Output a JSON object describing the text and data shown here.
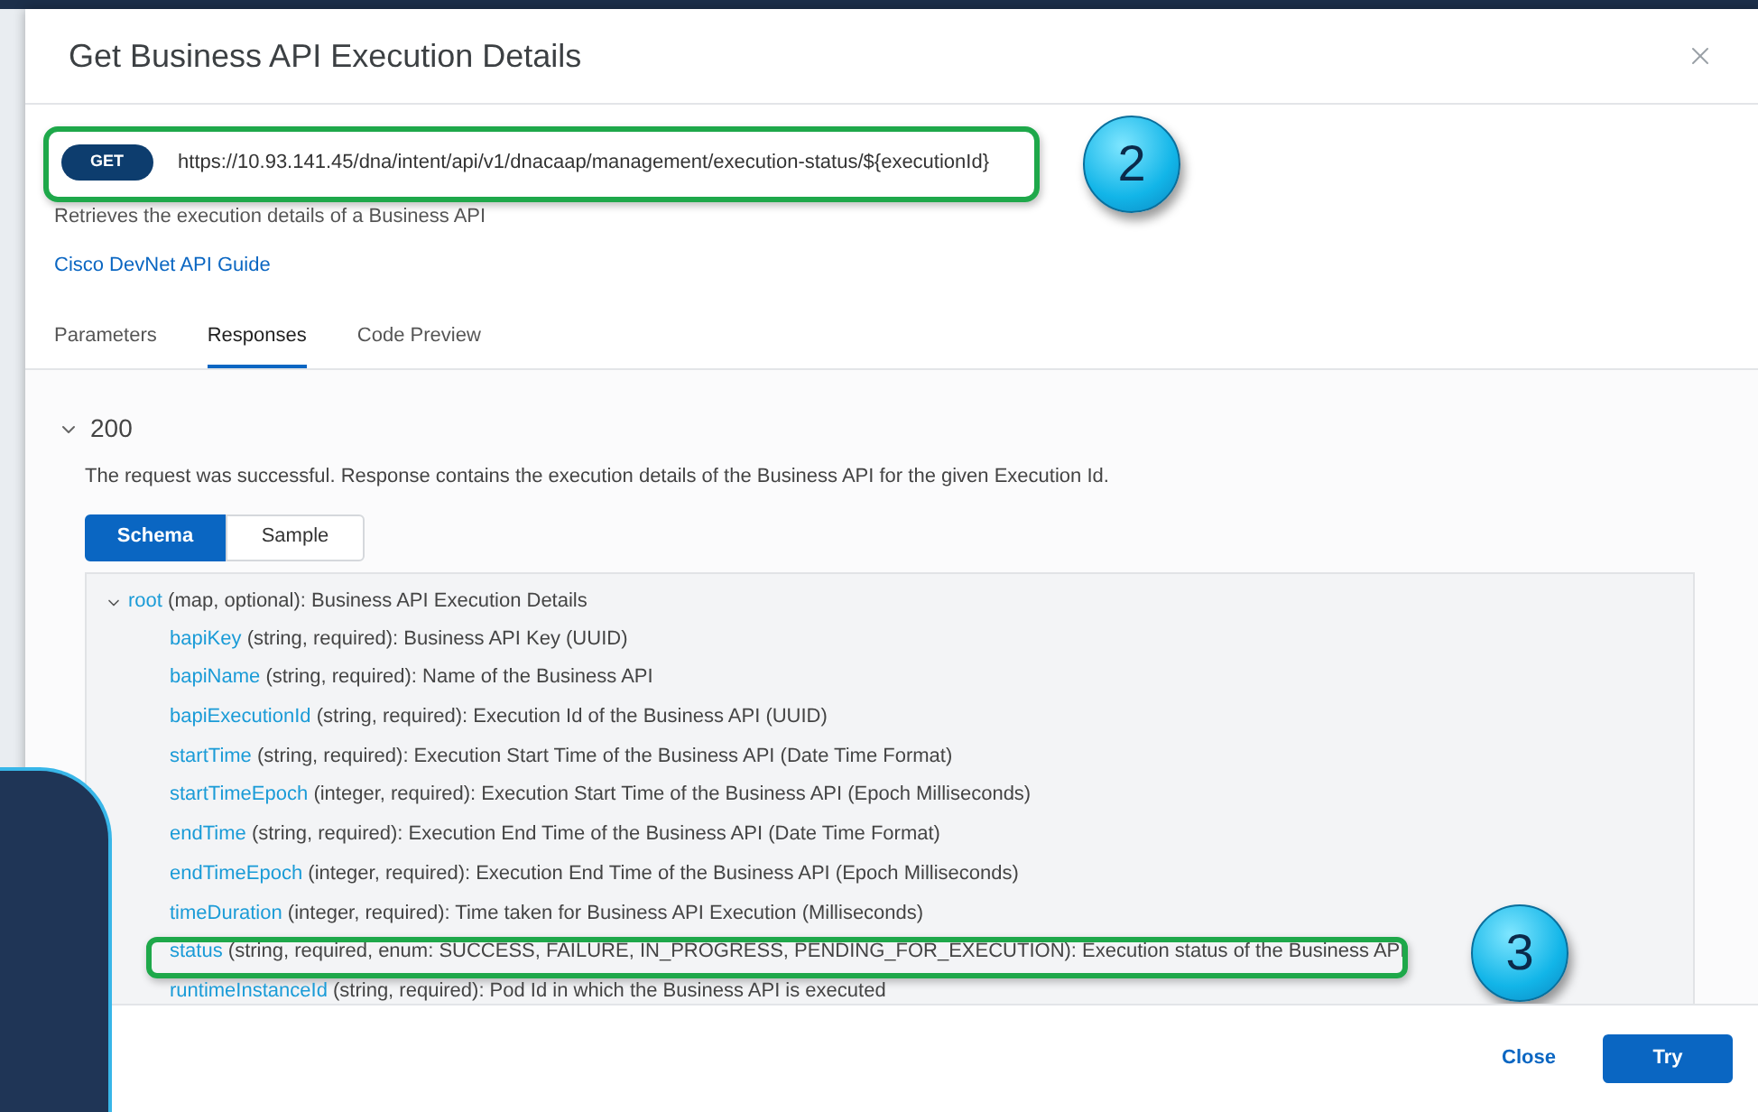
{
  "dialog": {
    "title": "Get Business API Execution Details"
  },
  "endpoint": {
    "method": "GET",
    "url": "https://10.93.141.45/dna/intent/api/v1/dnacaap/management/execution-status/${executionId}",
    "highlighted": true,
    "callout": "2"
  },
  "description": "Retrieves the execution details of a Business API",
  "guide_link": "Cisco DevNet API Guide",
  "tabs": [
    {
      "label": "Parameters",
      "selected": false
    },
    {
      "label": "Responses",
      "selected": true
    },
    {
      "label": "Code Preview",
      "selected": false
    }
  ],
  "response": {
    "code": "200",
    "expanded": true,
    "description": "The request was successful. Response contains the execution details of the Business API for the given Execution Id."
  },
  "view_toggle": [
    {
      "label": "Schema",
      "selected": true
    },
    {
      "label": "Sample",
      "selected": false
    }
  ],
  "schema": {
    "name": "root",
    "details": "(map, optional): Business API Execution Details",
    "expanded": true,
    "children": [
      {
        "name": "bapiKey",
        "details": "(string, required): Business API Key (UUID)",
        "highlighted": false
      },
      {
        "name": "bapiName",
        "details": "(string, required): Name of the Business API",
        "highlighted": false
      },
      {
        "name": "bapiExecutionId",
        "details": "(string, required): Execution Id of the Business API (UUID)",
        "highlighted": false
      },
      {
        "name": "startTime",
        "details": "(string, required): Execution Start Time of the Business API (Date Time Format)",
        "highlighted": false
      },
      {
        "name": "startTimeEpoch",
        "details": "(integer, required): Execution Start Time of the Business API (Epoch Milliseconds)",
        "highlighted": false
      },
      {
        "name": "endTime",
        "details": "(string, required): Execution End Time of the Business API (Date Time Format)",
        "highlighted": false
      },
      {
        "name": "endTimeEpoch",
        "details": "(integer, required): Execution End Time of the Business API (Epoch Milliseconds)",
        "highlighted": false
      },
      {
        "name": "timeDuration",
        "details": "(integer, required): Time taken for Business API Execution (Milliseconds)",
        "highlighted": false
      },
      {
        "name": "status",
        "details": "(string, required, enum: SUCCESS, FAILURE, IN_PROGRESS, PENDING_FOR_EXECUTION): Execution status of the Business API",
        "highlighted": true,
        "callout": "3"
      },
      {
        "name": "runtimeInstanceId",
        "details": "(string, required): Pod Id in which the Business API is executed",
        "highlighted": false
      }
    ]
  },
  "buttons": [
    {
      "label": "Close",
      "kind": "link"
    },
    {
      "label": "Try",
      "kind": "primary"
    }
  ]
}
